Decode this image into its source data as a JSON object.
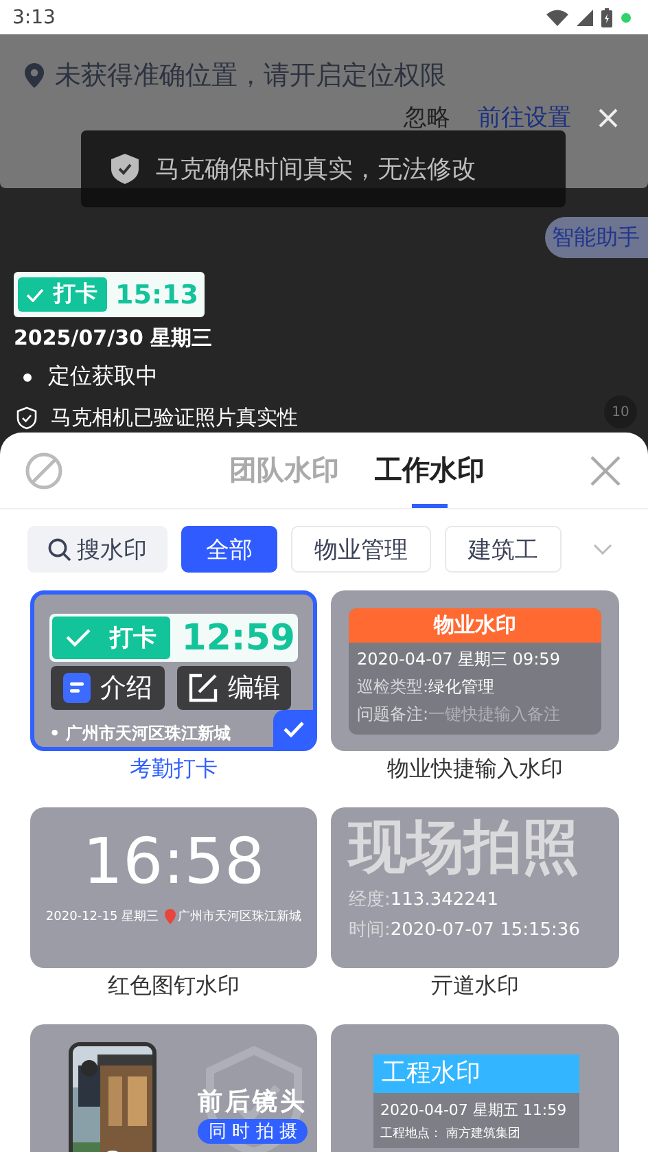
{
  "status_bar": {
    "time": "3:13"
  },
  "location_banner": {
    "message": "未获得准确位置，请开启定位权限",
    "buttons": [
      "忽略",
      "前往设置"
    ]
  },
  "toast": {
    "message": "马克确保时间真实，无法修改"
  },
  "assistant_button": "智能助手",
  "preview": {
    "badge": "打卡",
    "time": "15:13",
    "date": "2025/07/30 星期三",
    "location": "定位获取中",
    "verified": "马克相机已验证照片真实性",
    "photo_count": "10"
  },
  "sheet": {
    "tabs": [
      {
        "label": "团队水印",
        "selected": false
      },
      {
        "label": "工作水印",
        "selected": true
      }
    ],
    "search": {
      "label": "搜水印"
    },
    "categories": [
      {
        "label": "全部",
        "selected": true
      },
      {
        "label": "物业管理",
        "selected": false
      },
      {
        "label": "建筑工",
        "selected": false
      }
    ],
    "items": [
      {
        "kind": "checkin",
        "name": "考勤打卡",
        "selected": true,
        "badge": "打卡",
        "time": "12:59",
        "location": "• 广州市天河区珠江新城",
        "actions": [
          "介绍",
          "编辑"
        ]
      },
      {
        "kind": "property",
        "name": "物业快捷输入水印",
        "selected": false,
        "title": "物业水印",
        "datetime": "2020-04-07 星期三 09:59",
        "fields": [
          {
            "label": "巡检类型:",
            "value": "绿化管理"
          },
          {
            "label": "问题备注:",
            "placeholder": "一键快捷输入备注"
          }
        ]
      },
      {
        "kind": "clock",
        "name": "红色图钉水印",
        "selected": false,
        "time": "16:58",
        "date": "2020-12-15 星期三",
        "location": "广州市天河区珠江新城"
      },
      {
        "kind": "scene",
        "name": "亓道水印",
        "selected": false,
        "title": "现场拍照",
        "fields": [
          {
            "label": "经度:",
            "value": "113.342241"
          },
          {
            "label": "时间:",
            "value": "2020-07-07 15:15:36"
          }
        ]
      },
      {
        "kind": "dual",
        "selected": false,
        "title": "前后镜头",
        "subtitle": "同 时 拍 摄"
      },
      {
        "kind": "engineering",
        "selected": false,
        "title": "工程水印",
        "datetime": "2020-04-07 星期五 11:59",
        "location": "工程地点： 南方建筑集团"
      }
    ]
  }
}
